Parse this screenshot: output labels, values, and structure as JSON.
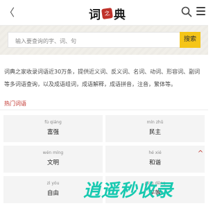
{
  "header": {
    "back_glyph": "〈",
    "logo_char_1": "词",
    "logo_seal": "之家",
    "logo_char_2": "典"
  },
  "search": {
    "placeholder": "输入要查询的字、词、句",
    "button_label": "搜索"
  },
  "intro": {
    "text": "词典之家收录词语近30万条，提供近义词、反义词、名词、动词、形容词、副词等多词语查询，以及成语组词，成语解释，成语拼音，注音，繁体等。"
  },
  "section": {
    "title": "热门词语"
  },
  "words": [
    {
      "pinyin": "fù qiáng",
      "word": "富强"
    },
    {
      "pinyin": "mín zhǔ",
      "word": "民主"
    },
    {
      "pinyin": "wén míng",
      "word": "文明"
    },
    {
      "pinyin": "hé xié",
      "word": "和谐"
    },
    {
      "pinyin": "zì yóu",
      "word": "自由"
    },
    {
      "pinyin": "píng děng",
      "word": "平等"
    }
  ],
  "back_to_top": "^",
  "watermark": "逍遥秒收录",
  "colors": {
    "accent_red": "#c0322b",
    "search_button": "#f5c518",
    "cell_bg": "#f4f4f4",
    "watermark": "#16c9b0"
  }
}
